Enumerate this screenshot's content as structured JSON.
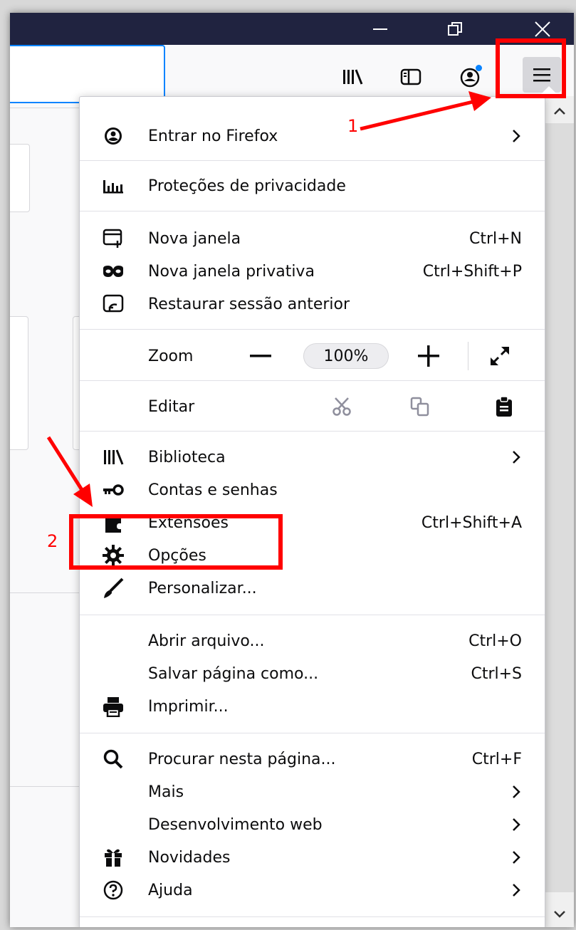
{
  "window": {
    "controls": [
      {
        "name": "minimize-icon"
      },
      {
        "name": "restore-icon"
      },
      {
        "name": "close-icon"
      }
    ]
  },
  "toolbar": {
    "icons": [
      "library-icon",
      "sidebar-icon",
      "account-icon",
      "hamburger-menu-icon"
    ],
    "account_notification": true
  },
  "menu": {
    "account": {
      "label": "Entrar no Firefox",
      "icon": "account-icon",
      "has_submenu": true
    },
    "privacy": {
      "label": "Proteções de privacidade",
      "icon": "privacy-chart-icon"
    },
    "windows": [
      {
        "label": "Nova janela",
        "shortcut": "Ctrl+N",
        "icon": "new-window-icon"
      },
      {
        "label": "Nova janela privativa",
        "shortcut": "Ctrl+Shift+P",
        "icon": "private-mask-icon"
      },
      {
        "label": "Restaurar sessão anterior",
        "shortcut": "",
        "icon": "restore-session-icon"
      }
    ],
    "zoom": {
      "label": "Zoom",
      "minus": "−",
      "value": "100%",
      "plus": "+"
    },
    "edit": {
      "label": "Editar",
      "icons": [
        "cut-icon",
        "copy-icon",
        "paste-icon"
      ]
    },
    "tools": [
      {
        "label": "Biblioteca",
        "shortcut": "",
        "icon": "library-icon",
        "has_submenu": true
      },
      {
        "label": "Contas e senhas",
        "shortcut": "",
        "icon": "key-icon",
        "has_submenu": false
      },
      {
        "label": "Extensões",
        "shortcut": "Ctrl+Shift+A",
        "icon": "puzzle-icon",
        "has_submenu": false
      },
      {
        "label": "Opções",
        "shortcut": "",
        "icon": "gear-icon",
        "has_submenu": false
      },
      {
        "label": "Personalizar...",
        "shortcut": "",
        "icon": "brush-icon",
        "has_submenu": false
      }
    ],
    "file": [
      {
        "label": "Abrir arquivo...",
        "shortcut": "Ctrl+O",
        "icon": ""
      },
      {
        "label": "Salvar página como...",
        "shortcut": "Ctrl+S",
        "icon": ""
      },
      {
        "label": "Imprimir...",
        "shortcut": "",
        "icon": "printer-icon"
      }
    ],
    "misc": [
      {
        "label": "Procurar nesta página...",
        "shortcut": "Ctrl+F",
        "icon": "search-icon",
        "has_submenu": false
      },
      {
        "label": "Mais",
        "shortcut": "",
        "icon": "",
        "has_submenu": true
      },
      {
        "label": "Desenvolvimento web",
        "shortcut": "",
        "icon": "",
        "has_submenu": true
      },
      {
        "label": "Novidades",
        "shortcut": "",
        "icon": "gift-icon",
        "has_submenu": true
      },
      {
        "label": "Ajuda",
        "shortcut": "",
        "icon": "help-icon",
        "has_submenu": true
      }
    ]
  },
  "annotations": {
    "step1": "1",
    "step2": "2",
    "color": "#ff0000"
  },
  "colors": {
    "titlebar": "#202340",
    "accent": "#0a84ff"
  }
}
